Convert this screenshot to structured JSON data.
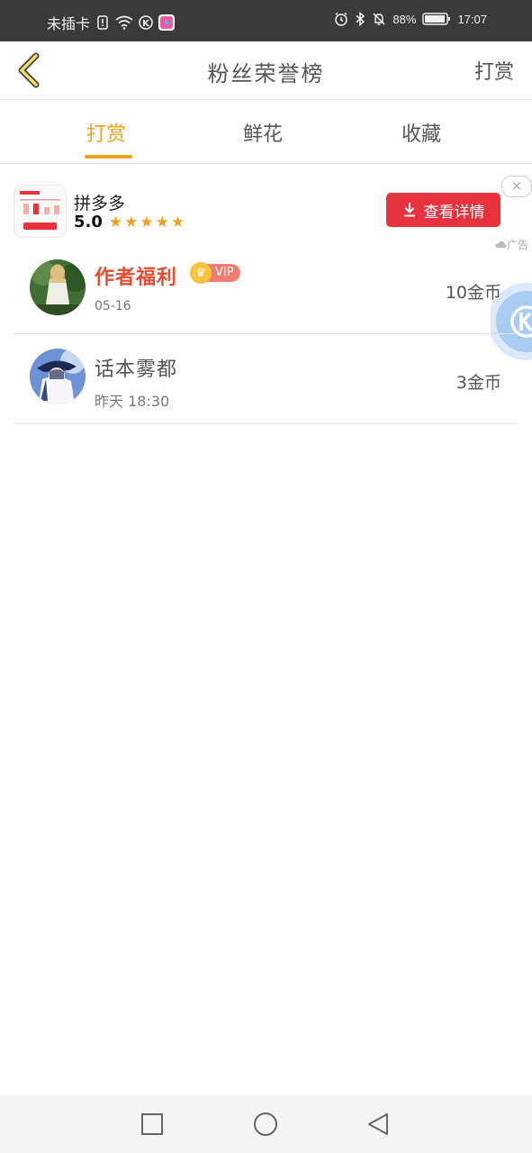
{
  "status_bar": {
    "carrier": "未插卡",
    "battery": "88%",
    "time": "17:07",
    "icons": [
      "sim-alert-icon",
      "wifi-icon",
      "k-app-icon",
      "video-app-icon",
      "alarm-icon",
      "bluetooth-icon",
      "mute-icon",
      "battery-icon"
    ]
  },
  "header": {
    "back_icon": "chevron-left-icon",
    "title": "粉丝荣誉榜",
    "action": "打赏"
  },
  "tabs": [
    {
      "label": "打赏",
      "active": true
    },
    {
      "label": "鲜花",
      "active": false
    },
    {
      "label": "收藏",
      "active": false
    }
  ],
  "ad": {
    "app_name": "拼多多",
    "rating": "5.0",
    "stars": "★★★★★",
    "cta": "查看详情",
    "label": "广告",
    "close": "×"
  },
  "list": [
    {
      "name": "作者福利",
      "vip": "VIP",
      "date": "05-16",
      "amount": "10金币"
    },
    {
      "name": "话本雾都",
      "date": "昨天 18:30",
      "amount": "3金币"
    }
  ],
  "colors": {
    "accent": "#f0a020",
    "ad_button": "#e8323e",
    "author_name": "#e84b2e",
    "status_bar": "#3a3a3a"
  }
}
